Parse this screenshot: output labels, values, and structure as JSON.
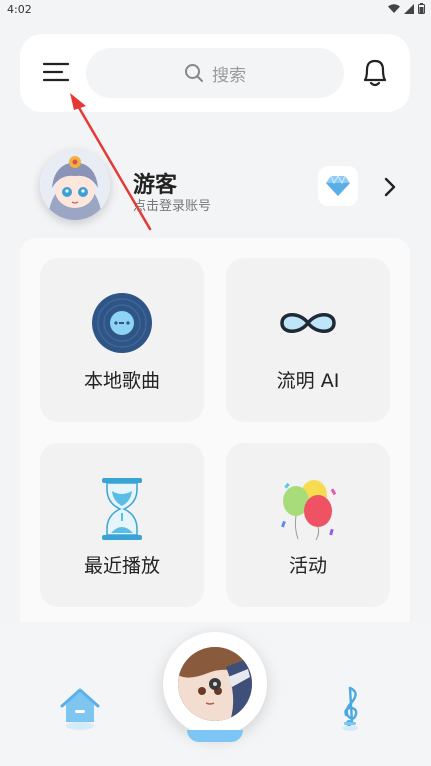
{
  "status_bar": {
    "time": "4:02"
  },
  "header": {
    "search_placeholder": "搜索"
  },
  "profile": {
    "name": "游客",
    "subtitle": "点击登录账号"
  },
  "tiles": [
    {
      "label": "本地歌曲",
      "icon": "vinyl-record-icon"
    },
    {
      "label": "流明 AI",
      "icon": "infinity-icon"
    },
    {
      "label": "最近播放",
      "icon": "hourglass-icon"
    },
    {
      "label": "活动",
      "icon": "balloons-icon"
    }
  ],
  "bottom_nav": {
    "items": [
      {
        "icon": "home-icon"
      },
      {
        "icon": "player-disc"
      },
      {
        "icon": "music-note-icon"
      }
    ]
  },
  "colors": {
    "background": "#f3f4f6",
    "card": "#ffffff",
    "tile": "#f2f2f2",
    "accent_blue": "#5ab8f0",
    "annotation_red": "#e53935"
  }
}
